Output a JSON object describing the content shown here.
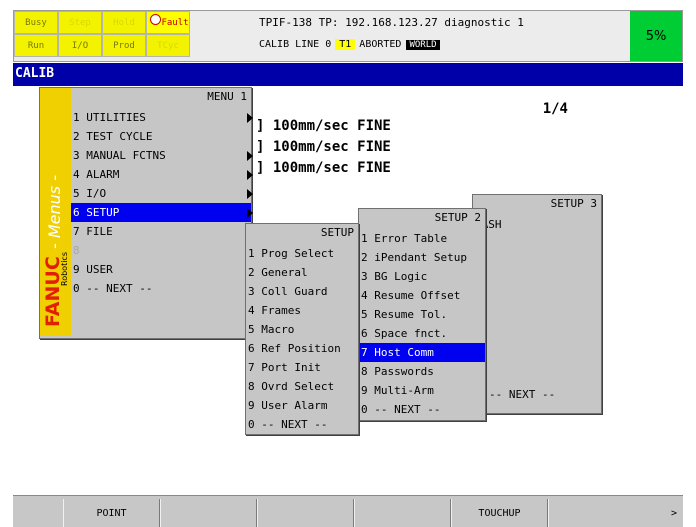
{
  "status": {
    "indicators_row1": [
      "Busy",
      "Step",
      "Hold",
      "Fault"
    ],
    "indicators_row2": [
      "Run",
      "I/O",
      "Prod",
      "TCyc"
    ],
    "line1": "TPIF-138 TP: 192.168.123.27 diagnostic 1",
    "line2_prefix": "CALIB LINE 0",
    "t_mode": "T1",
    "line2_state": "ABORTED",
    "coord": "WORLD",
    "override": "5%"
  },
  "title": "CALIB",
  "page_indicator": "1/4",
  "program_lines": [
    "] 100mm/sec FINE",
    "] 100mm/sec FINE",
    "] 100mm/sec FINE"
  ],
  "main_menu": {
    "header": "MENU  1",
    "brand_side": "- Menus -",
    "logo": "FANUC",
    "logo_sub": "Robotics",
    "items": [
      {
        "label": "1 UTILITIES"
      },
      {
        "label": "2 TEST CYCLE"
      },
      {
        "label": "3 MANUAL FCTNS"
      },
      {
        "label": "4 ALARM"
      },
      {
        "label": "5 I/O"
      },
      {
        "label": "6 SETUP"
      },
      {
        "label": "7 FILE"
      },
      {
        "label": "8"
      },
      {
        "label": "9 USER"
      },
      {
        "label": "0 -- NEXT --"
      }
    ]
  },
  "setup_menu1": {
    "header": "SETUP",
    "items": [
      "1 Prog Select",
      "2 General",
      "3 Coll Guard",
      "4 Frames",
      "5 Macro",
      "6 Ref Position",
      "7 Port Init",
      "8 Ovrd Select",
      "9 User Alarm",
      "0 -- NEXT --"
    ]
  },
  "setup_menu2": {
    "header": "SETUP  2",
    "items": [
      "1 Error Table",
      "2 iPendant Setup",
      "3 BG Logic",
      "4 Resume Offset",
      "5 Resume Tol.",
      "6 Space fnct.",
      "7 Host Comm",
      "8 Passwords",
      "9 Multi-Arm",
      "0 -- NEXT --"
    ]
  },
  "setup_menu3": {
    "header": "SETUP  3",
    "first_item": "MASH",
    "next": "-- NEXT --"
  },
  "function_keys": [
    "POINT",
    "",
    "",
    "",
    "TOUCHUP",
    ">"
  ],
  "colors": {
    "title_bar": "#0000a8",
    "selection": "#0000f0",
    "override": "#00cc33",
    "indicator": "#f3f300",
    "brand": "#f0d000",
    "brand_text": "#e02000"
  }
}
